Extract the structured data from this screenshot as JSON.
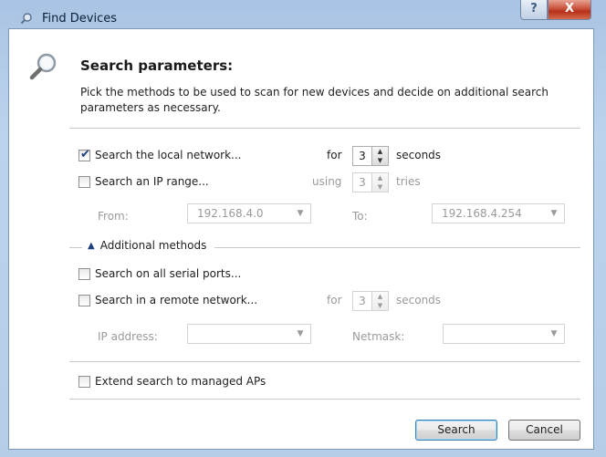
{
  "window": {
    "title": "Find Devices",
    "help_glyph": "?",
    "close_glyph": "X"
  },
  "header": {
    "heading": "Search parameters:",
    "description": "Pick the methods to be used to scan for new devices and decide on additional search parameters as necessary."
  },
  "local": {
    "checkbox_label": "Search the local network...",
    "checked": true,
    "for_label": "for",
    "seconds_value": "3",
    "seconds_label": "seconds"
  },
  "ip_range": {
    "checkbox_label": "Search an IP range...",
    "checked": false,
    "using_label": "using",
    "tries_value": "3",
    "tries_label": "tries",
    "from_label": "From:",
    "from_value": "192.168.4.0",
    "to_label": "To:",
    "to_value": "192.168.4.254"
  },
  "additional": {
    "group_label": "Additional methods",
    "serial_label": "Search on all serial ports...",
    "remote_label": "Search in a remote network...",
    "remote_for_label": "for",
    "remote_seconds_value": "3",
    "remote_seconds_label": "seconds",
    "ip_address_label": "IP address:",
    "ip_address_value": "",
    "netmask_label": "Netmask:",
    "netmask_value": ""
  },
  "managed_aps": {
    "checkbox_label": "Extend search to managed APs"
  },
  "buttons": {
    "search": "Search",
    "cancel": "Cancel"
  },
  "glyphs": {
    "check": "✔",
    "up": "▲",
    "down": "▼",
    "chevron_up": "⌃"
  },
  "colors": {
    "title_bar": "#a9c4e3",
    "close_button": "#c9523b",
    "default_button_border": "#3c7fb1"
  }
}
